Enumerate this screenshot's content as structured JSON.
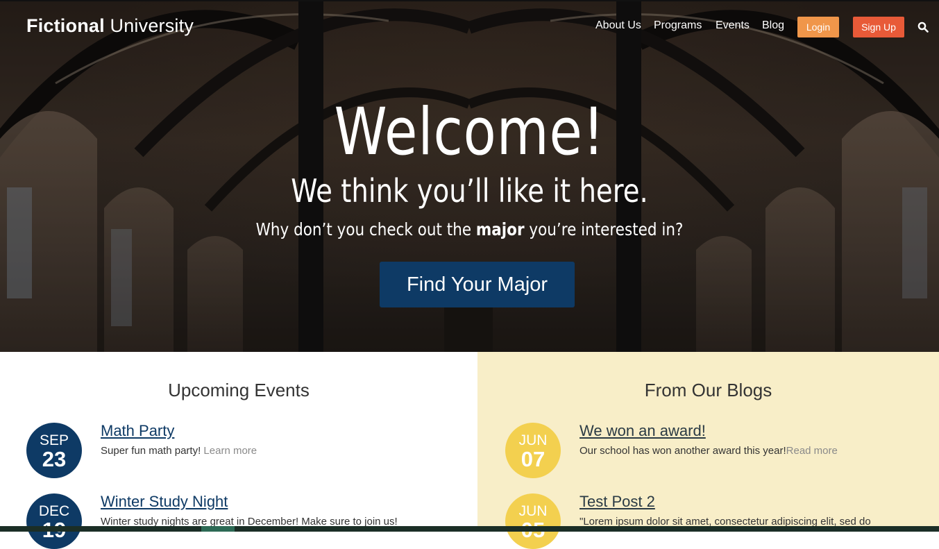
{
  "brand": {
    "bold": "Fictional",
    "light": "University"
  },
  "nav": {
    "items": [
      "About Us",
      "Programs",
      "Events",
      "Blog"
    ],
    "login": "Login",
    "signup": "Sign Up"
  },
  "hero": {
    "title": "Welcome!",
    "subtitle": "We think you’ll like it here.",
    "question_before": "Why don’t you check out the ",
    "question_bold": "major",
    "question_after": " you’re interested in?",
    "cta": "Find Your Major"
  },
  "events": {
    "title": "Upcoming Events",
    "items": [
      {
        "month": "SEP",
        "day": "23",
        "title": "Math Party",
        "text": "Super fun math party! ",
        "more": "Learn more"
      },
      {
        "month": "DEC",
        "day": "19",
        "title": "Winter Study Night",
        "text": "Winter study nights are great in December! Make sure to join us!",
        "more": ""
      }
    ]
  },
  "blogs": {
    "title": "From Our Blogs",
    "items": [
      {
        "month": "JUN",
        "day": "07",
        "title": "We won an award!",
        "text": "Our school has won another award this year!",
        "more": "Read more"
      },
      {
        "month": "JUN",
        "day": "05",
        "title": "Test Post 2",
        "text": "\"Lorem ipsum dolor sit amet, consectetur adipiscing elit, sed do",
        "more": ""
      }
    ]
  },
  "colors": {
    "navy": "#0e3a65",
    "gold": "#f3d04f",
    "login": "#f0964a",
    "signup": "#e85a38",
    "blogs_bg": "#f8eec8"
  },
  "icons": {
    "search": "search-icon"
  }
}
